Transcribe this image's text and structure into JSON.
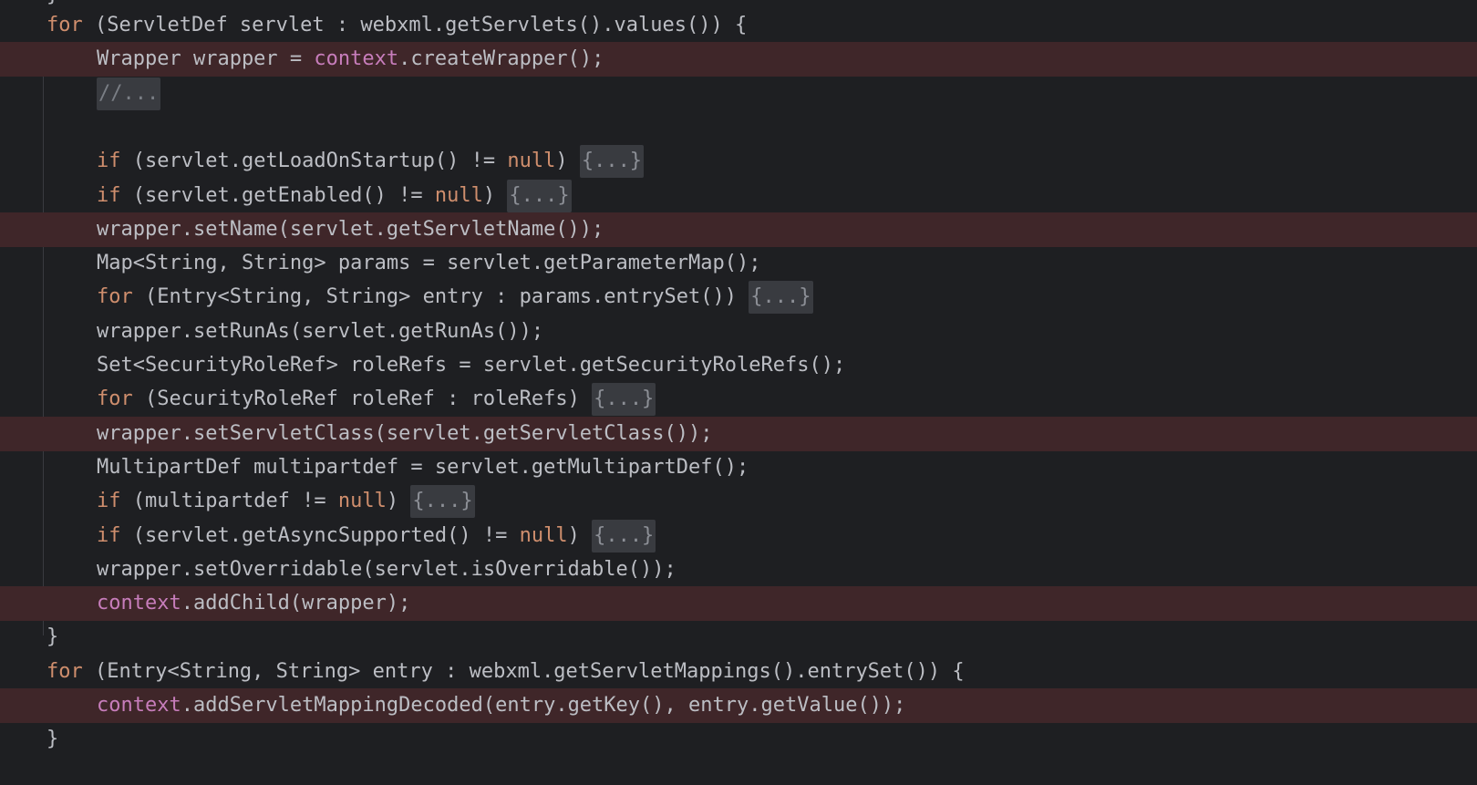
{
  "top_stub": "}",
  "lines": [
    {
      "indent": 1,
      "hl": false,
      "parts": [
        {
          "t": "kw",
          "v": "for"
        },
        {
          "t": "plain",
          "v": " (ServletDef servlet : webxml.getServlets().values()) {"
        }
      ]
    },
    {
      "indent": 2,
      "hl": true,
      "parts": [
        {
          "t": "plain",
          "v": "Wrapper wrapper = "
        },
        {
          "t": "fld",
          "v": "context"
        },
        {
          "t": "plain",
          "v": ".createWrapper();"
        }
      ]
    },
    {
      "indent": 2,
      "hl": false,
      "parts": [
        {
          "t": "comment-fold",
          "v": "//..."
        }
      ]
    },
    {
      "indent": 2,
      "hl": false,
      "parts": []
    },
    {
      "indent": 2,
      "hl": false,
      "parts": [
        {
          "t": "kw",
          "v": "if"
        },
        {
          "t": "plain",
          "v": " (servlet.getLoadOnStartup() != "
        },
        {
          "t": "kw",
          "v": "null"
        },
        {
          "t": "plain",
          "v": ") "
        },
        {
          "t": "fold",
          "v": "{...}"
        }
      ]
    },
    {
      "indent": 2,
      "hl": false,
      "parts": [
        {
          "t": "kw",
          "v": "if"
        },
        {
          "t": "plain",
          "v": " (servlet.getEnabled() != "
        },
        {
          "t": "kw",
          "v": "null"
        },
        {
          "t": "plain",
          "v": ") "
        },
        {
          "t": "fold",
          "v": "{...}"
        }
      ]
    },
    {
      "indent": 2,
      "hl": true,
      "parts": [
        {
          "t": "plain",
          "v": "wrapper.setName(servlet.getServletName());"
        }
      ]
    },
    {
      "indent": 2,
      "hl": false,
      "parts": [
        {
          "t": "plain",
          "v": "Map<String, String> params = servlet.getParameterMap();"
        }
      ]
    },
    {
      "indent": 2,
      "hl": false,
      "parts": [
        {
          "t": "kw",
          "v": "for"
        },
        {
          "t": "plain",
          "v": " (Entry<String, String> entry : params.entrySet()) "
        },
        {
          "t": "fold",
          "v": "{...}"
        }
      ]
    },
    {
      "indent": 2,
      "hl": false,
      "parts": [
        {
          "t": "plain",
          "v": "wrapper.setRunAs(servlet.getRunAs());"
        }
      ]
    },
    {
      "indent": 2,
      "hl": false,
      "parts": [
        {
          "t": "plain",
          "v": "Set<SecurityRoleRef> roleRefs = servlet.getSecurityRoleRefs();"
        }
      ]
    },
    {
      "indent": 2,
      "hl": false,
      "parts": [
        {
          "t": "kw",
          "v": "for"
        },
        {
          "t": "plain",
          "v": " (SecurityRoleRef roleRef : roleRefs) "
        },
        {
          "t": "fold",
          "v": "{...}"
        }
      ]
    },
    {
      "indent": 2,
      "hl": true,
      "parts": [
        {
          "t": "plain",
          "v": "wrapper.setServletClass(servlet.getServletClass());"
        }
      ]
    },
    {
      "indent": 2,
      "hl": false,
      "parts": [
        {
          "t": "plain",
          "v": "MultipartDef multipartdef = servlet.getMultipartDef();"
        }
      ]
    },
    {
      "indent": 2,
      "hl": false,
      "parts": [
        {
          "t": "kw",
          "v": "if"
        },
        {
          "t": "plain",
          "v": " (multipartdef != "
        },
        {
          "t": "kw",
          "v": "null"
        },
        {
          "t": "plain",
          "v": ") "
        },
        {
          "t": "fold",
          "v": "{...}"
        }
      ]
    },
    {
      "indent": 2,
      "hl": false,
      "parts": [
        {
          "t": "kw",
          "v": "if"
        },
        {
          "t": "plain",
          "v": " (servlet.getAsyncSupported() != "
        },
        {
          "t": "kw",
          "v": "null"
        },
        {
          "t": "plain",
          "v": ") "
        },
        {
          "t": "fold",
          "v": "{...}"
        }
      ]
    },
    {
      "indent": 2,
      "hl": false,
      "parts": [
        {
          "t": "plain",
          "v": "wrapper.setOverridable(servlet.isOverridable());"
        }
      ]
    },
    {
      "indent": 2,
      "hl": true,
      "parts": [
        {
          "t": "fld",
          "v": "context"
        },
        {
          "t": "plain",
          "v": ".addChild(wrapper);"
        }
      ]
    },
    {
      "indent": 1,
      "hl": false,
      "parts": [
        {
          "t": "plain",
          "v": "}"
        }
      ]
    },
    {
      "indent": 1,
      "hl": false,
      "parts": [
        {
          "t": "kw",
          "v": "for"
        },
        {
          "t": "plain",
          "v": " (Entry<String, String> entry : webxml.getServletMappings().entrySet()) {"
        }
      ]
    },
    {
      "indent": 2,
      "hl": true,
      "parts": [
        {
          "t": "fld",
          "v": "context"
        },
        {
          "t": "plain",
          "v": ".addServletMappingDecoded(entry.getKey(), entry.getValue());"
        }
      ]
    },
    {
      "indent": 1,
      "hl": false,
      "parts": [
        {
          "t": "plain",
          "v": "}"
        }
      ]
    }
  ]
}
